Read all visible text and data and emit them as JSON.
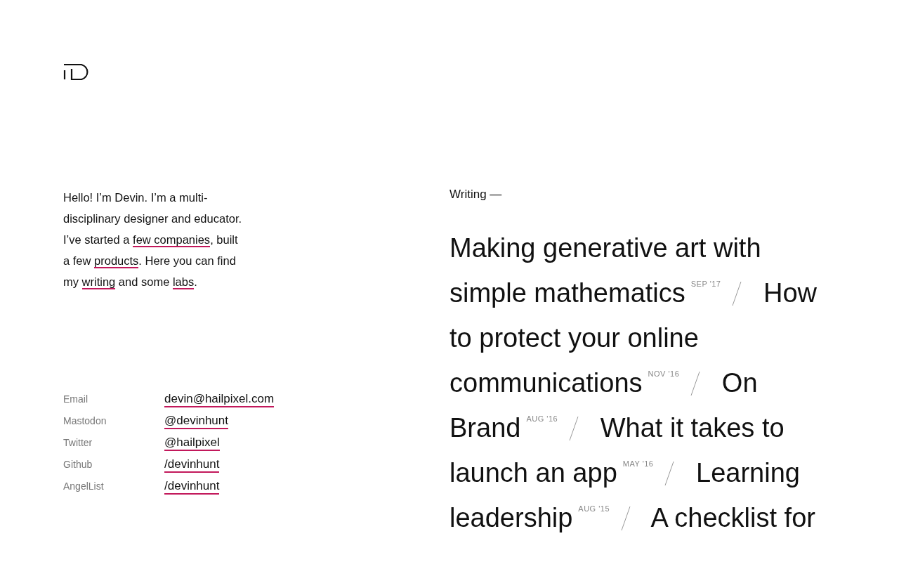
{
  "intro": [
    {
      "kind": "text",
      "text": "Hello! I’m Devin. I’m a multi-disciplinary designer and educator. I’ve started a "
    },
    {
      "kind": "link",
      "text": "few companies"
    },
    {
      "kind": "text",
      "text": ", built a few "
    },
    {
      "kind": "link",
      "text": "products"
    },
    {
      "kind": "text",
      "text": ". Here you can find my "
    },
    {
      "kind": "link",
      "text": "writing"
    },
    {
      "kind": "text",
      "text": " and some "
    },
    {
      "kind": "link",
      "text": "labs"
    },
    {
      "kind": "text",
      "text": "."
    }
  ],
  "contacts": [
    {
      "label": "Email",
      "value": "devin@hailpixel.com"
    },
    {
      "label": "Mastodon",
      "value": "@devinhunt"
    },
    {
      "label": "Twitter",
      "value": "@hailpixel"
    },
    {
      "label": "Github",
      "value": "/devinhunt"
    },
    {
      "label": "AngelList",
      "value": "/devinhunt"
    }
  ],
  "writing": {
    "heading": "Writing —",
    "posts": [
      {
        "title_lines": [
          "Making generative art with",
          "simple mathematics"
        ],
        "date": "SEP '17"
      },
      {
        "title_lines": [
          "How",
          "to protect your online",
          "communications"
        ],
        "date": "NOV '16"
      },
      {
        "title_lines": [
          "On",
          "Brand"
        ],
        "date": "AUG '16"
      },
      {
        "title_lines": [
          "What it takes to",
          "launch an app"
        ],
        "date": "MAY '16"
      },
      {
        "title_lines": [
          "Learning",
          "leadership"
        ],
        "date": "AUG '15"
      },
      {
        "title_lines": [
          "A checklist for"
        ]
      }
    ]
  }
}
